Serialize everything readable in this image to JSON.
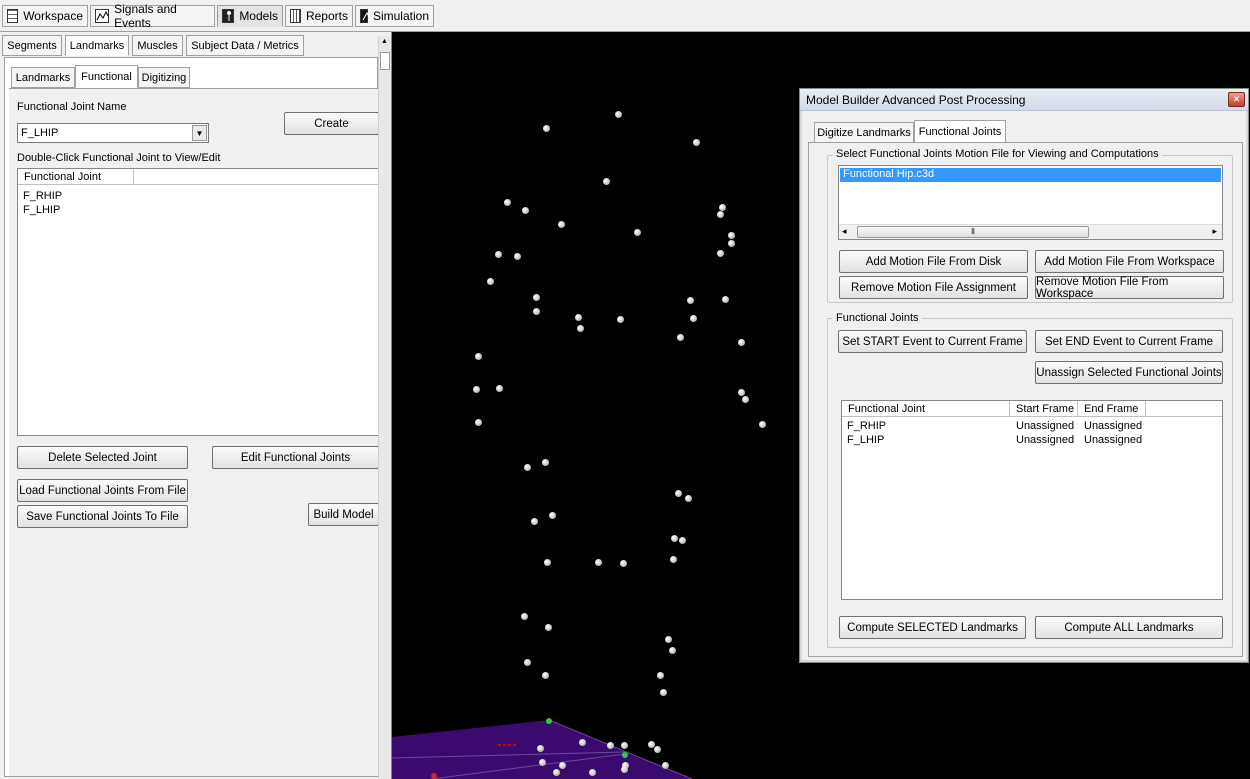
{
  "top_tabs": [
    {
      "label": "Workspace",
      "icon": "grid-icon"
    },
    {
      "label": "Signals and Events",
      "icon": "signal-icon"
    },
    {
      "label": "Models",
      "icon": "model-icon"
    },
    {
      "label": "Reports",
      "icon": "report-icon"
    },
    {
      "label": "Simulation",
      "icon": "simulation-icon"
    }
  ],
  "left": {
    "tabs": [
      "Segments",
      "Landmarks",
      "Muscles",
      "Subject Data / Metrics"
    ],
    "subtabs": [
      "Landmarks",
      "Functional",
      "Digitizing"
    ],
    "joint_name_label": "Functional Joint Name",
    "joint_name_value": "F_LHIP",
    "create_button": "Create",
    "list_label": "Double-Click Functional Joint to View/Edit",
    "list_header": "Functional Joint",
    "list_items": [
      "F_RHIP",
      "F_LHIP"
    ],
    "delete_button": "Delete Selected Joint",
    "edit_button": "Edit Functional Joints",
    "load_button": "Load Functional Joints From File",
    "save_button": "Save Functional Joints To File",
    "build_button": "Build Model"
  },
  "dialog": {
    "title": "Model Builder Advanced Post Processing",
    "close_glyph": "✕",
    "tabs": [
      "Digitize Landmarks",
      "Functional Joints"
    ],
    "motion_group_label": "Select Functional Joints Motion File for Viewing and Computations",
    "motion_files": [
      "Functional Hip.c3d"
    ],
    "scroll_left": "◂",
    "scroll_right": "▸",
    "scroll_grip": "⦀",
    "add_disk_button": "Add Motion File From Disk",
    "add_workspace_button": "Add Motion File From Workspace",
    "remove_assignment_button": "Remove Motion File Assignment",
    "remove_workspace_button": "Remove Motion File From Workspace",
    "joints_group_label": "Functional Joints",
    "set_start_button": "Set START Event to Current Frame",
    "set_end_button": "Set END Event to Current Frame",
    "unassign_button": "Unassign Selected Functional Joints",
    "table_headers": [
      "Functional Joint",
      "Start Frame",
      "End Frame"
    ],
    "table_rows": [
      [
        "F_RHIP",
        "Unassigned",
        "Unassigned"
      ],
      [
        "F_LHIP",
        "Unassigned",
        "Unassigned"
      ]
    ],
    "compute_selected_button": "Compute SELECTED Landmarks",
    "compute_all_button": "Compute ALL Landmarks"
  },
  "colors": {
    "viewport_bg": "#000000",
    "floor": "#3a0a6e",
    "selection": "#3399ff",
    "marker": "#d0d0d0"
  }
}
